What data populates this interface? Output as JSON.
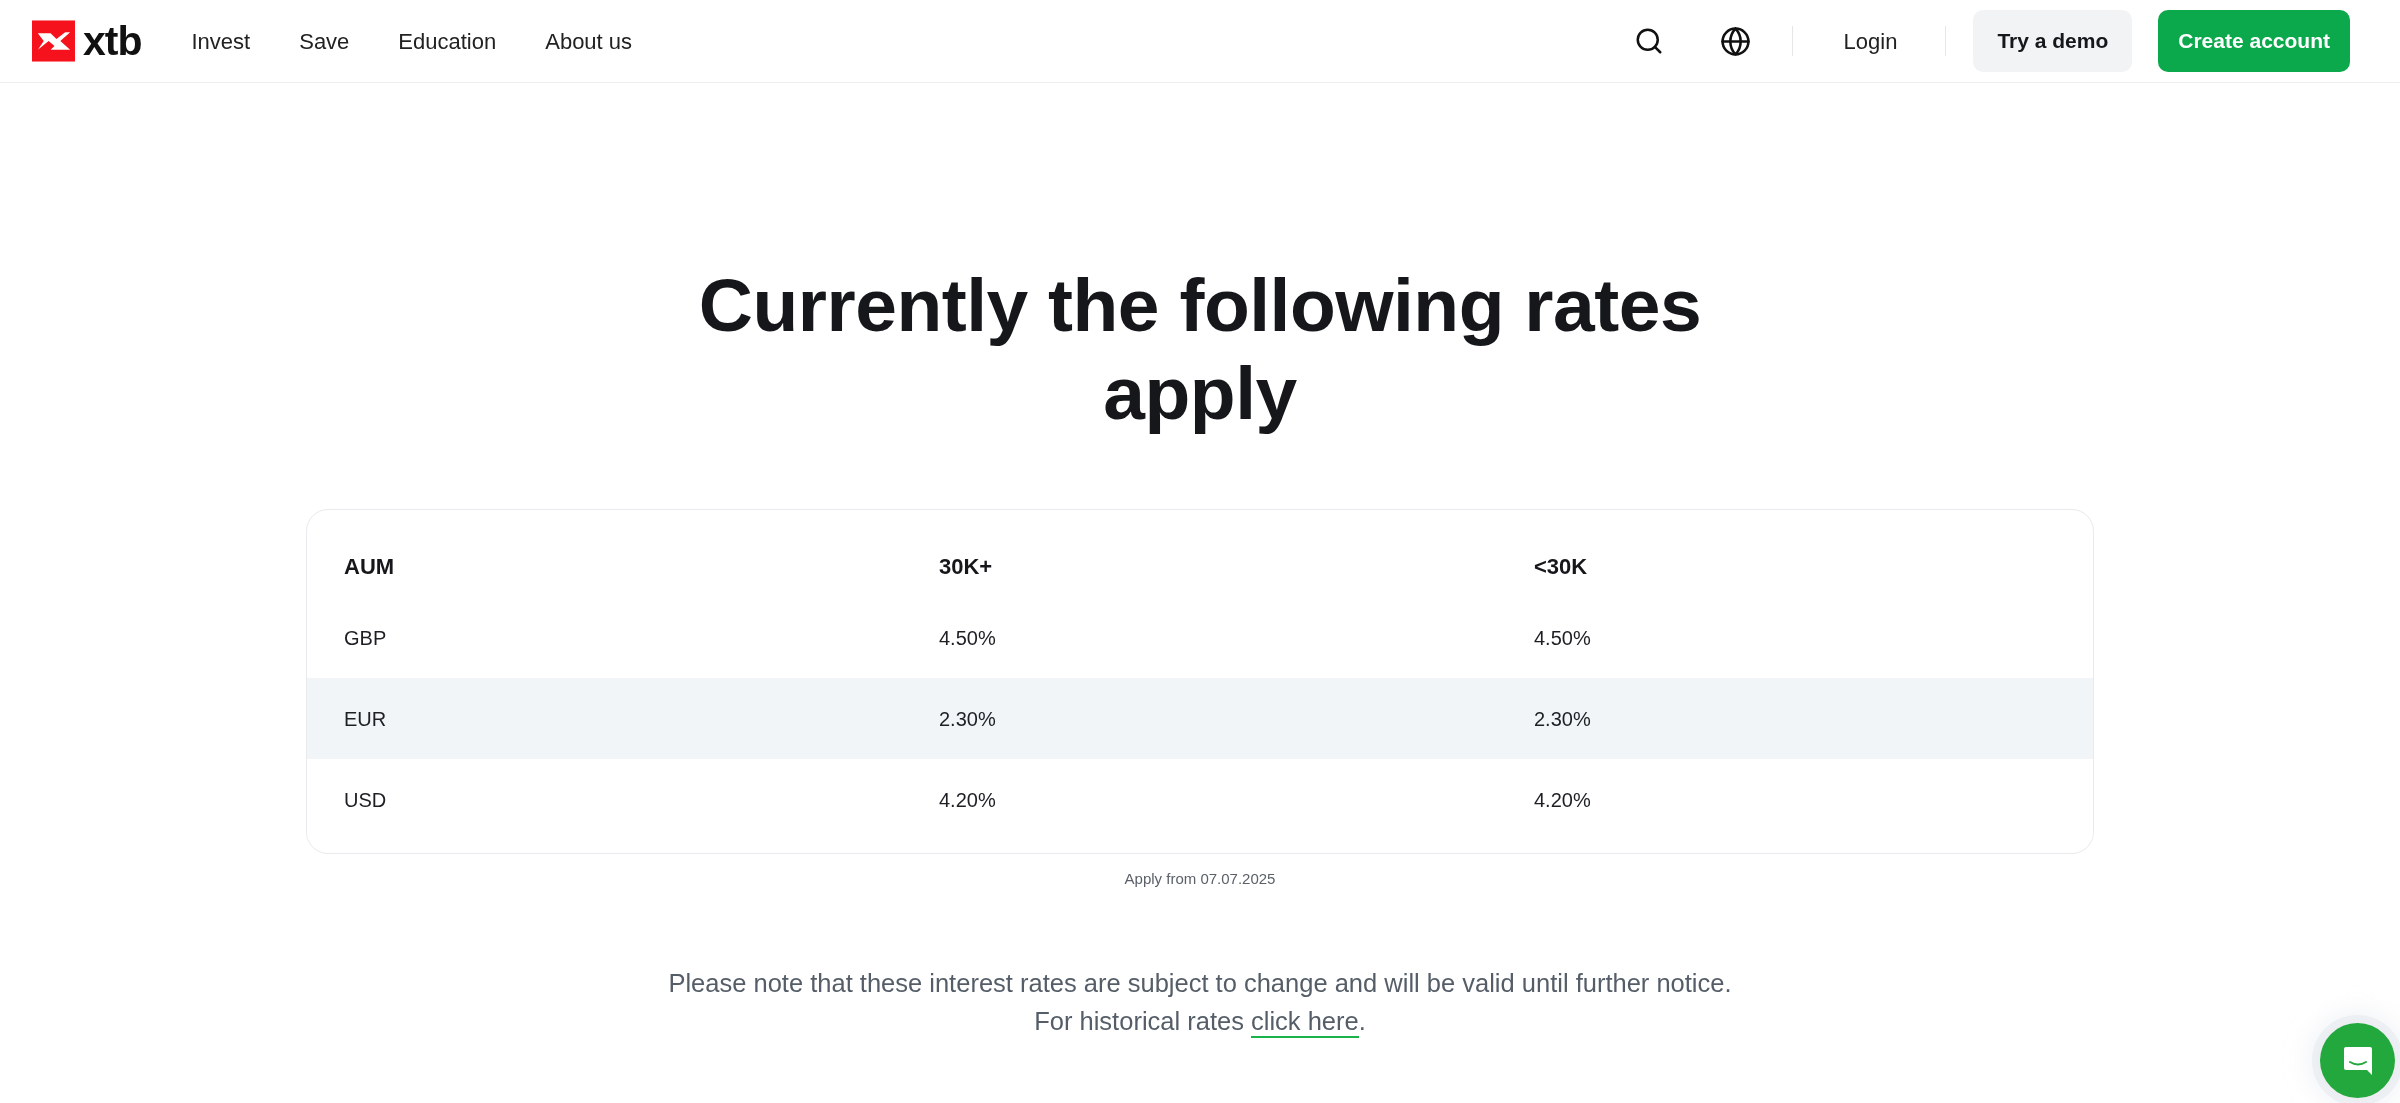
{
  "header": {
    "logo_text": "xtb",
    "nav": [
      "Invest",
      "Save",
      "Education",
      "About us"
    ],
    "login": "Login",
    "demo_button": "Try a demo",
    "create_button": "Create account"
  },
  "heading": "Currently the following rates apply",
  "rates_table": {
    "columns": [
      "AUM",
      "30K+",
      "<30K"
    ],
    "rows": [
      {
        "cells": [
          "GBP",
          "4.50%",
          "4.50%"
        ],
        "highlighted": false
      },
      {
        "cells": [
          "EUR",
          "2.30%",
          "2.30%"
        ],
        "highlighted": true
      },
      {
        "cells": [
          "USD",
          "4.20%",
          "4.20%"
        ],
        "highlighted": false
      }
    ]
  },
  "table_note": "Apply from 07.07.2025",
  "notice": {
    "text": "Please note that these interest rates are subject to change and will be valid until further notice.",
    "prefix": "For historical rates",
    "link": "click here",
    "suffix": "."
  }
}
